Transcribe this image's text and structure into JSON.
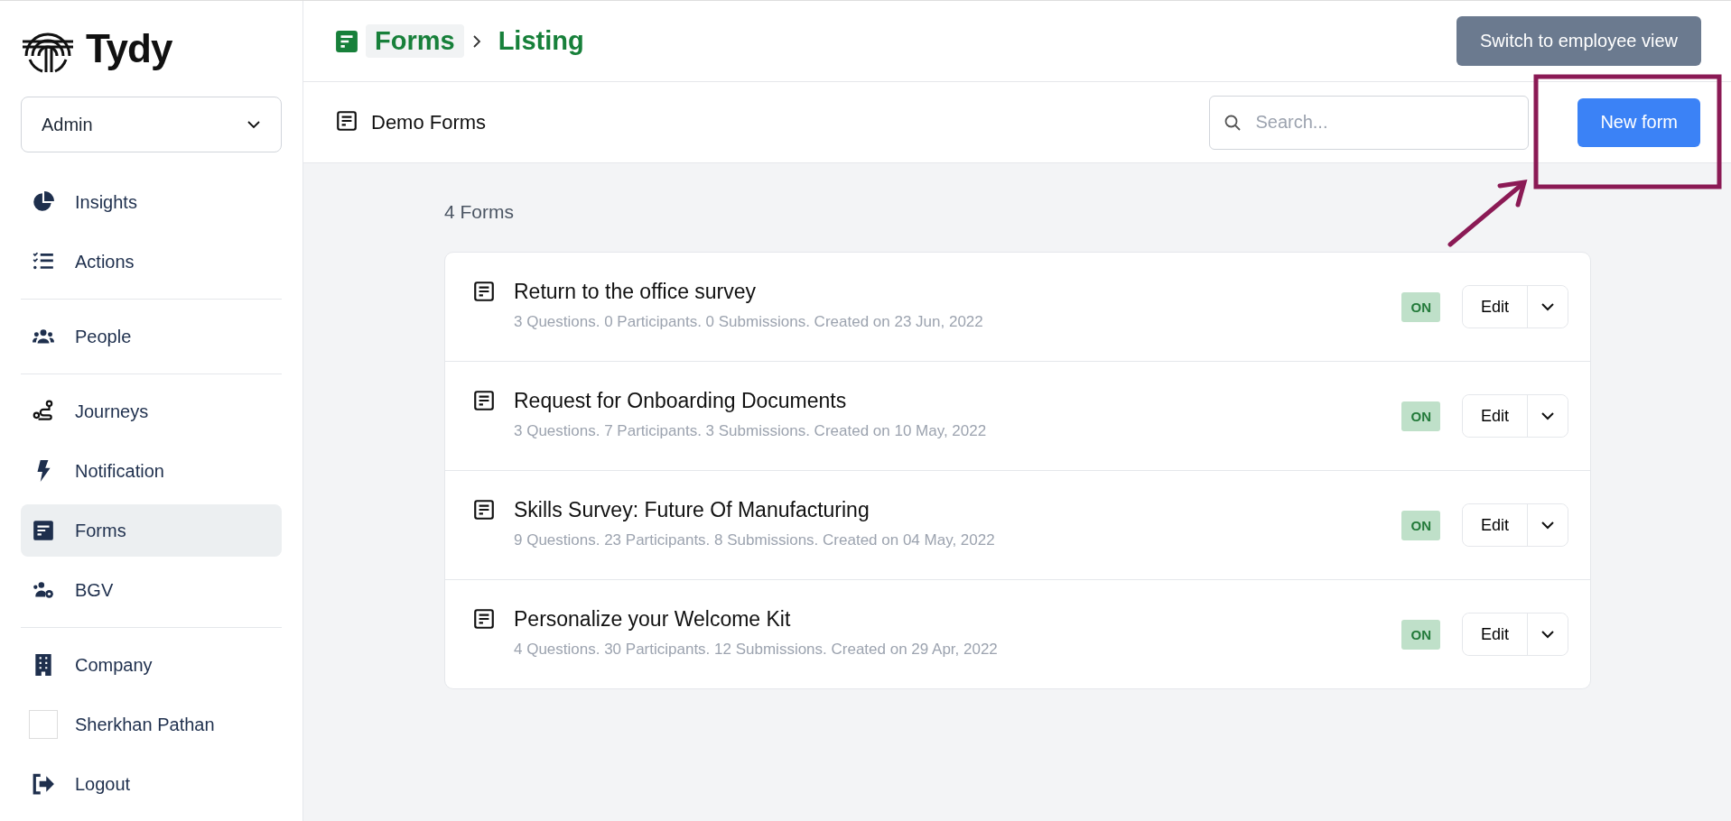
{
  "brand": {
    "name": "Tydy"
  },
  "role_select": {
    "value": "Admin"
  },
  "sidebar": {
    "sections": [
      [
        {
          "label": "Insights",
          "kind": "link",
          "selected": false
        },
        {
          "label": "Actions",
          "kind": "link",
          "selected": false
        }
      ],
      [
        {
          "label": "People",
          "kind": "link",
          "selected": false
        }
      ],
      [
        {
          "label": "Journeys",
          "kind": "link",
          "selected": false
        },
        {
          "label": "Notification",
          "kind": "link",
          "selected": false
        },
        {
          "label": "Forms",
          "kind": "link",
          "selected": true
        },
        {
          "label": "BGV",
          "kind": "link",
          "selected": false
        }
      ],
      [
        {
          "label": "Company",
          "kind": "link",
          "selected": false
        },
        {
          "label": "Sherkhan Pathan",
          "kind": "user",
          "selected": false
        },
        {
          "label": "Logout",
          "kind": "link",
          "selected": false
        }
      ]
    ]
  },
  "breadcrumb": [
    {
      "label": "Forms",
      "current": false
    },
    {
      "label": "Listing",
      "current": true
    }
  ],
  "switch_button": "Switch to employee view",
  "page_title": "Demo Forms",
  "search": {
    "placeholder": "Search..."
  },
  "new_button": "New form",
  "count": "4 Forms",
  "forms": [
    {
      "title": "Return to the office survey",
      "meta": "3 Questions. 0 Participants. 0 Submissions. Created on 23 Jun, 2022",
      "status": "ON",
      "on": true,
      "edit": "Edit"
    },
    {
      "title": "Request for Onboarding Documents",
      "meta": "3 Questions. 7 Participants. 3 Submissions. Created on 10 May, 2022",
      "status": "ON",
      "on": true,
      "edit": "Edit"
    },
    {
      "title": "Skills Survey: Future Of Manufacturing",
      "meta": "9 Questions. 23 Participants. 8 Submissions. Created on 04 May, 2022",
      "status": "ON",
      "on": true,
      "edit": "Edit"
    },
    {
      "title": "Personalize your Welcome Kit",
      "meta": "4 Questions. 30 Participants. 12 Submissions. Created on 29 Apr, 2022",
      "status": "ON",
      "on": true,
      "edit": "Edit"
    }
  ]
}
